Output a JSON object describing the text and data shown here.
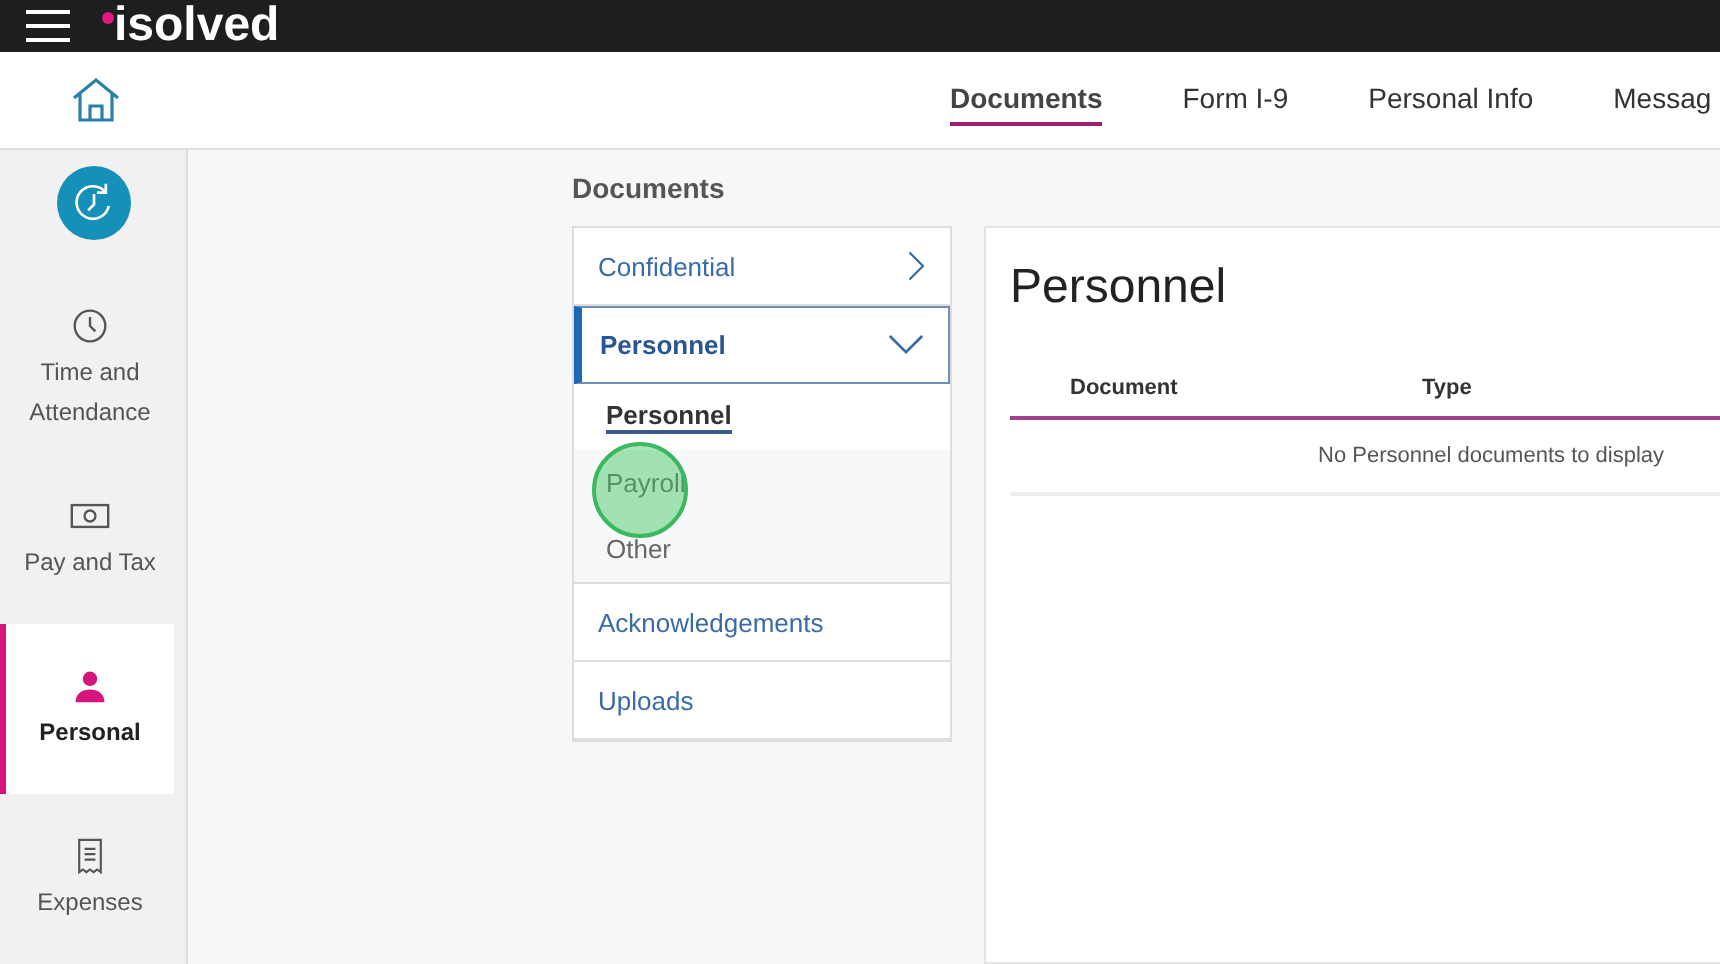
{
  "header": {
    "logo": "isolved"
  },
  "tabs": [
    {
      "label": "Documents",
      "selected": true
    },
    {
      "label": "Form I-9",
      "selected": false
    },
    {
      "label": "Personal Info",
      "selected": false
    },
    {
      "label": "Messag",
      "selected": false
    }
  ],
  "sidebar": {
    "items": [
      {
        "kind": "clock",
        "label": "Time and Attendance",
        "selected": false
      },
      {
        "kind": "money",
        "label": "Pay and Tax",
        "selected": false
      },
      {
        "kind": "person",
        "label": "Personal",
        "selected": true
      },
      {
        "kind": "receipt",
        "label": "Expenses",
        "selected": false
      }
    ]
  },
  "section_title": "Documents",
  "categories": [
    {
      "label": "Confidential",
      "expandable": true,
      "expanded": false,
      "selected": false
    },
    {
      "label": "Personnel",
      "expandable": true,
      "expanded": true,
      "selected": true,
      "children": [
        {
          "label": "Personnel",
          "selected": true
        },
        {
          "label": "Payroll",
          "selected": false
        },
        {
          "label": "Other",
          "selected": false
        }
      ]
    },
    {
      "label": "Acknowledgements",
      "expandable": false,
      "expanded": false,
      "selected": false
    },
    {
      "label": "Uploads",
      "expandable": false,
      "expanded": false,
      "selected": false
    }
  ],
  "panel": {
    "title": "Personnel",
    "columns": [
      "Document",
      "Type"
    ],
    "empty_message": "No Personnel documents to display"
  }
}
